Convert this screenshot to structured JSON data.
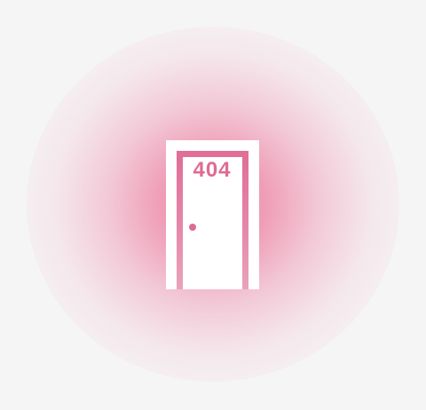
{
  "error": {
    "code": "404"
  },
  "colors": {
    "background": "#f5f5f5",
    "glow": "#ec608c",
    "accent": "#df6b93",
    "door": "#ffffff"
  },
  "icons": {
    "door": "door-icon",
    "knob": "door-knob-icon"
  }
}
